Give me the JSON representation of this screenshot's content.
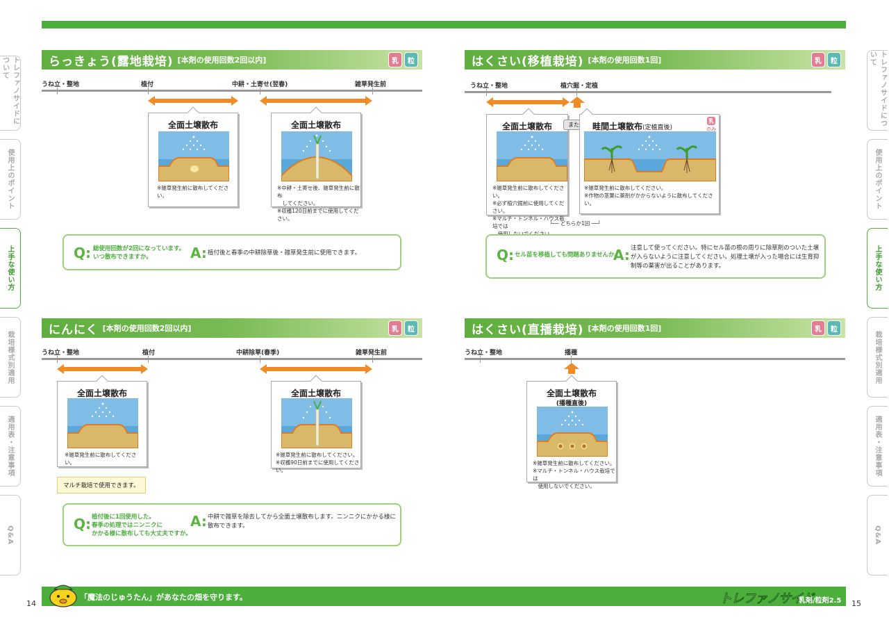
{
  "side_tabs": [
    {
      "label": "トレファノサイドについて",
      "active": false
    },
    {
      "label": "使用上のポイント",
      "active": false
    },
    {
      "label": "上手な使い方",
      "active": true
    },
    {
      "label": "栽培様式別適用",
      "active": false
    },
    {
      "label": "適用表・注意事項",
      "active": false
    },
    {
      "label": "Q&A",
      "active": false
    }
  ],
  "badges": {
    "emulsion": "乳",
    "granule": "粒",
    "only": "のみ"
  },
  "sections": {
    "rakkyo": {
      "title": "らっきょう(露地栽培)",
      "subtitle": "[本剤の使用回数2回以内]",
      "timeline": [
        "うね立・整地",
        "植付",
        "中耕・土寄せ(翌春)",
        "雑草発生前"
      ],
      "cards": [
        {
          "title": "全面土壌散布",
          "note": "※雑草発生前に散布してください。"
        },
        {
          "title": "全面土壌散布",
          "note": "※中耕・土寄せ後、雑草発生前に散布\n　してください。\n※収穫120日前までに使用してください。"
        }
      ],
      "qa": {
        "q": "総使用回数が2回になっています。\nいつ散布できますか。",
        "a": "植付後と春季の中耕除草後・雑草発生前に使用できます。"
      }
    },
    "hakusai_transplant": {
      "title": "はくさい(移植栽培)",
      "subtitle": "[本剤の使用回数1回]",
      "timeline": [
        "うね立・整地",
        "植穴掘・定植"
      ],
      "cards": [
        {
          "title": "全面土壌散布",
          "note": "※雑草発生前に散布してください。\n※必ず植穴掘前に使用してください。\n※マルチ・トンネル・ハウス栽培では\n　使用しないでください。"
        },
        {
          "title": "畦間土壌散布",
          "title_sub": "(定植直後)",
          "note": "※雑草発生前に散布してください。\n※作物の茎葉に薬剤がかからないように散布してください。"
        }
      ],
      "or_label": "または",
      "either_label": "どちらか1回",
      "qa": {
        "q": "セル苗を移植しても問題ありませんか。",
        "a": "注意して使ってください。特にセル苗の根の周りに除草剤のついた土壌\nが入らないように注意してください。処理土壌が入った場合には生育抑\n制等の薬害が出ることがあります。"
      }
    },
    "garlic": {
      "title": "にんにく",
      "subtitle": "[本剤の使用回数2回以内]",
      "timeline": [
        "うね立・整地",
        "植付",
        "中耕除草(春季)",
        "雑草発生前"
      ],
      "cards": [
        {
          "title": "全面土壌散布",
          "note": "※雑草発生前に散布してください。"
        },
        {
          "title": "全面土壌散布",
          "note": "※雑草発生前に散布してください。\n※収穫90日前までに使用してください。"
        }
      ],
      "mulch_note": "マルチ栽培で使用できます。",
      "qa": {
        "q": "植付後に1回使用した。\n春季の処理ではニンニクに\nかかる様に散布しても大丈夫ですか。",
        "a": "中耕で雑草を除去してから全面土壌散布します。ニンニクにかかる様に\n散布できます。"
      }
    },
    "hakusai_direct": {
      "title": "はくさい(直播栽培)",
      "subtitle": "[本剤の使用回数1回]",
      "timeline": [
        "うね立・整地",
        "播種"
      ],
      "cards": [
        {
          "title": "全面土壌散布",
          "title_sub": "(播種直後)",
          "note": "※雑草発生前に散布してください。\n※マルチ・トンネル・ハウス栽培では\n　使用しないでください。"
        }
      ]
    }
  },
  "qa_marks": {
    "q": "Q:",
    "a": "A:"
  },
  "footer": {
    "slogan": "「魔法のじゅうたん」があなたの畑を守ります。",
    "brand": "トレファノサイド",
    "brand_sub": "乳剤/粒剤2.5"
  },
  "page_numbers": {
    "left": "14",
    "right": "15"
  },
  "colors": {
    "green": "#4caf3c",
    "orange": "#f08c28",
    "soil": "#d9b86a",
    "sky": "#5aa7dc"
  }
}
